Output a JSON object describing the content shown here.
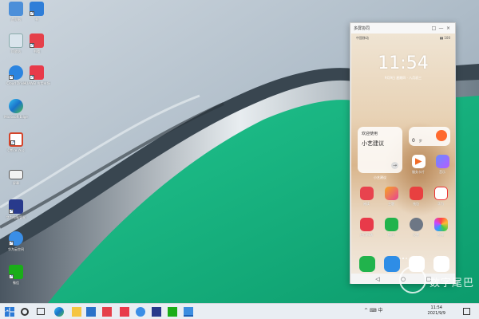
{
  "colors": {
    "wallpaper_green": "#12b07c",
    "taskbar_bg": "#e9eef3",
    "phone_bg": "#e8d2b5"
  },
  "desktop_icons": [
    {
      "name": "此电脑",
      "icon": "computer-icon"
    },
    {
      "name": "书",
      "icon": "book-icon"
    },
    {
      "name": "回收站",
      "icon": "recycle-bin-icon"
    },
    {
      "name": "书籍",
      "icon": "reader-icon"
    },
    {
      "name": "Cloud Drive",
      "icon": "chat-icon"
    },
    {
      "name": "HUAWEI 应用市场",
      "icon": "huawei-store-icon"
    },
    {
      "name": "Microsoft Edge",
      "icon": "edge-icon"
    },
    {
      "name": "Office 办公",
      "icon": "office-icon"
    },
    {
      "name": "屏幕",
      "icon": "monitor-icon"
    },
    {
      "name": "华为电脑管家",
      "icon": "pc-manager-icon"
    },
    {
      "name": "华为云空间",
      "icon": "cloud-icon"
    },
    {
      "name": "微信",
      "icon": "wechat-icon"
    }
  ],
  "phone_window": {
    "title": "多屏协同",
    "controls": [
      "□",
      "—",
      "×"
    ],
    "status_left": "中国移动",
    "status_right": "▮▮ 100",
    "clock": "11:54",
    "date": "9月9日 星期四 · 八月初三",
    "card_left": {
      "line1": "欢迎使用",
      "line2": "小艺建议",
      "arrow": "→",
      "caption": "小艺建议"
    },
    "card_right": {
      "value": "0",
      "unit": "步",
      "caption": "服务卡片"
    },
    "apps_row1": [
      {
        "label": "服务卡片"
      },
      {
        "label": "音乐"
      }
    ],
    "apps_row2": [
      {
        "label": "阅读"
      },
      {
        "label": "主题"
      },
      {
        "label": "钱包"
      },
      {
        "label": "华为"
      }
    ],
    "apps_row3": [
      {
        "label": "应用市场"
      },
      {
        "label": "畅连"
      },
      {
        "label": "设置"
      },
      {
        "label": "图库"
      }
    ],
    "dock_apps": [
      "phone-icon",
      "message-icon",
      "browser-icon",
      "camera-icon"
    ],
    "nav": [
      "◁",
      "○",
      "□"
    ]
  },
  "watermark": "数字尾巴",
  "taskbar": {
    "time": "11:54",
    "date": "2021/9/9",
    "tray": "^ ⌨ 中"
  }
}
